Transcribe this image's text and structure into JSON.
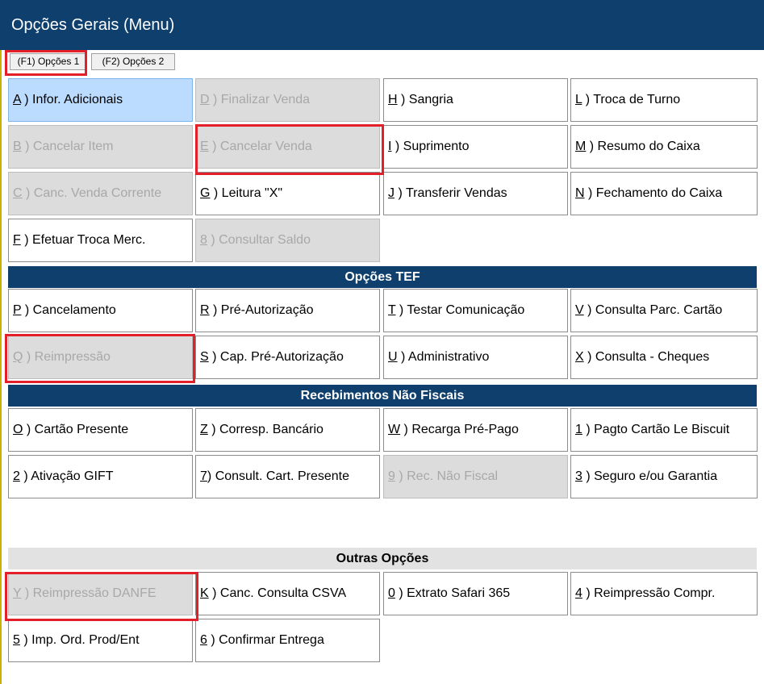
{
  "window": {
    "title": "Opções Gerais (Menu)"
  },
  "tabs": [
    {
      "label": "(F1) Opções 1"
    },
    {
      "label": "(F2) Opções 2"
    }
  ],
  "buttons": [
    {
      "key": "A",
      "sep": " ) ",
      "text": "Infor. Adicionais",
      "state": "selected"
    },
    {
      "key": "D",
      "sep": " ) ",
      "text": "Finalizar Venda",
      "state": "disabled"
    },
    {
      "key": "H",
      "sep": " ) ",
      "text": "Sangria",
      "state": "enabled"
    },
    {
      "key": "L",
      "sep": " ) ",
      "text": "Troca de Turno",
      "state": "enabled"
    },
    {
      "key": "B",
      "sep": " ) ",
      "text": "Cancelar Item",
      "state": "disabled"
    },
    {
      "key": "E",
      "sep": " ) ",
      "text": "Cancelar Venda",
      "state": "disabled"
    },
    {
      "key": "I",
      "sep": " ) ",
      "text": "Suprimento",
      "state": "enabled"
    },
    {
      "key": "M",
      "sep": " ) ",
      "text": "Resumo do Caixa",
      "state": "enabled"
    },
    {
      "key": "C",
      "sep": " ) ",
      "text": "Canc. Venda Corrente",
      "state": "disabled"
    },
    {
      "key": "G",
      "sep": " ) ",
      "text": "Leitura \"X\"",
      "state": "enabled"
    },
    {
      "key": "J",
      "sep": " ) ",
      "text": "Transferir Vendas",
      "state": "enabled"
    },
    {
      "key": "N",
      "sep": " ) ",
      "text": "Fechamento do Caixa",
      "state": "enabled"
    },
    {
      "key": "F",
      "sep": " ) ",
      "text": "Efetuar Troca Merc.",
      "state": "enabled"
    },
    {
      "key": "8",
      "sep": " ) ",
      "text": "Consultar Saldo",
      "state": "disabled"
    },
    {
      "key": "P",
      "sep": " ) ",
      "text": "Cancelamento",
      "state": "enabled"
    },
    {
      "key": "R",
      "sep": " ) ",
      "text": "Pré-Autorização",
      "state": "enabled"
    },
    {
      "key": "T",
      "sep": " ) ",
      "text": "Testar Comunicação",
      "state": "enabled"
    },
    {
      "key": "V",
      "sep": " ) ",
      "text": "Consulta Parc. Cartão",
      "state": "enabled"
    },
    {
      "key": "Q",
      "sep": " ) ",
      "text": "Reimpressão",
      "state": "disabled"
    },
    {
      "key": "S",
      "sep": " ) ",
      "text": "Cap. Pré-Autorização",
      "state": "enabled"
    },
    {
      "key": "U",
      "sep": " ) ",
      "text": "Administrativo",
      "state": "enabled"
    },
    {
      "key": "X",
      "sep": " ) ",
      "text": "Consulta - Cheques",
      "state": "enabled"
    },
    {
      "key": "O",
      "sep": " ) ",
      "text": "Cartão Presente",
      "state": "enabled"
    },
    {
      "key": "Z",
      "sep": " ) ",
      "text": "Corresp. Bancário",
      "state": "enabled"
    },
    {
      "key": "W",
      "sep": " ) ",
      "text": "Recarga Pré-Pago",
      "state": "enabled"
    },
    {
      "key": "1",
      "sep": " ) ",
      "text": "Pagto Cartão Le Biscuit",
      "state": "enabled"
    },
    {
      "key": "2",
      "sep": " ) ",
      "text": "Ativação GIFT",
      "state": "enabled"
    },
    {
      "key": "7",
      "sep": ") ",
      "text": "Consult. Cart. Presente",
      "state": "enabled"
    },
    {
      "key": "9",
      "sep": " ) ",
      "text": "Rec. Não Fiscal",
      "state": "disabled"
    },
    {
      "key": "3",
      "sep": " ) ",
      "text": "Seguro e/ou Garantia",
      "state": "enabled"
    },
    {
      "key": "Y",
      "sep": " ) ",
      "text": "Reimpressão DANFE",
      "state": "disabled"
    },
    {
      "key": "K",
      "sep": " ) ",
      "text": "Canc. Consulta CSVA",
      "state": "enabled"
    },
    {
      "key": "0",
      "sep": " ) ",
      "text": "Extrato Safari 365",
      "state": "enabled"
    },
    {
      "key": "4",
      "sep": " ) ",
      "text": "Reimpressão Compr.",
      "state": "enabled"
    },
    {
      "key": "5",
      "sep": " ) ",
      "text": "Imp. Ord. Prod/Ent",
      "state": "enabled"
    },
    {
      "key": "6",
      "sep": " ) ",
      "text": "Confirmar Entrega",
      "state": "enabled"
    }
  ],
  "sections": {
    "tef": "Opções TEF",
    "nonfiscal": "Recebimentos Não Fiscais",
    "other": "Outras Opções"
  }
}
